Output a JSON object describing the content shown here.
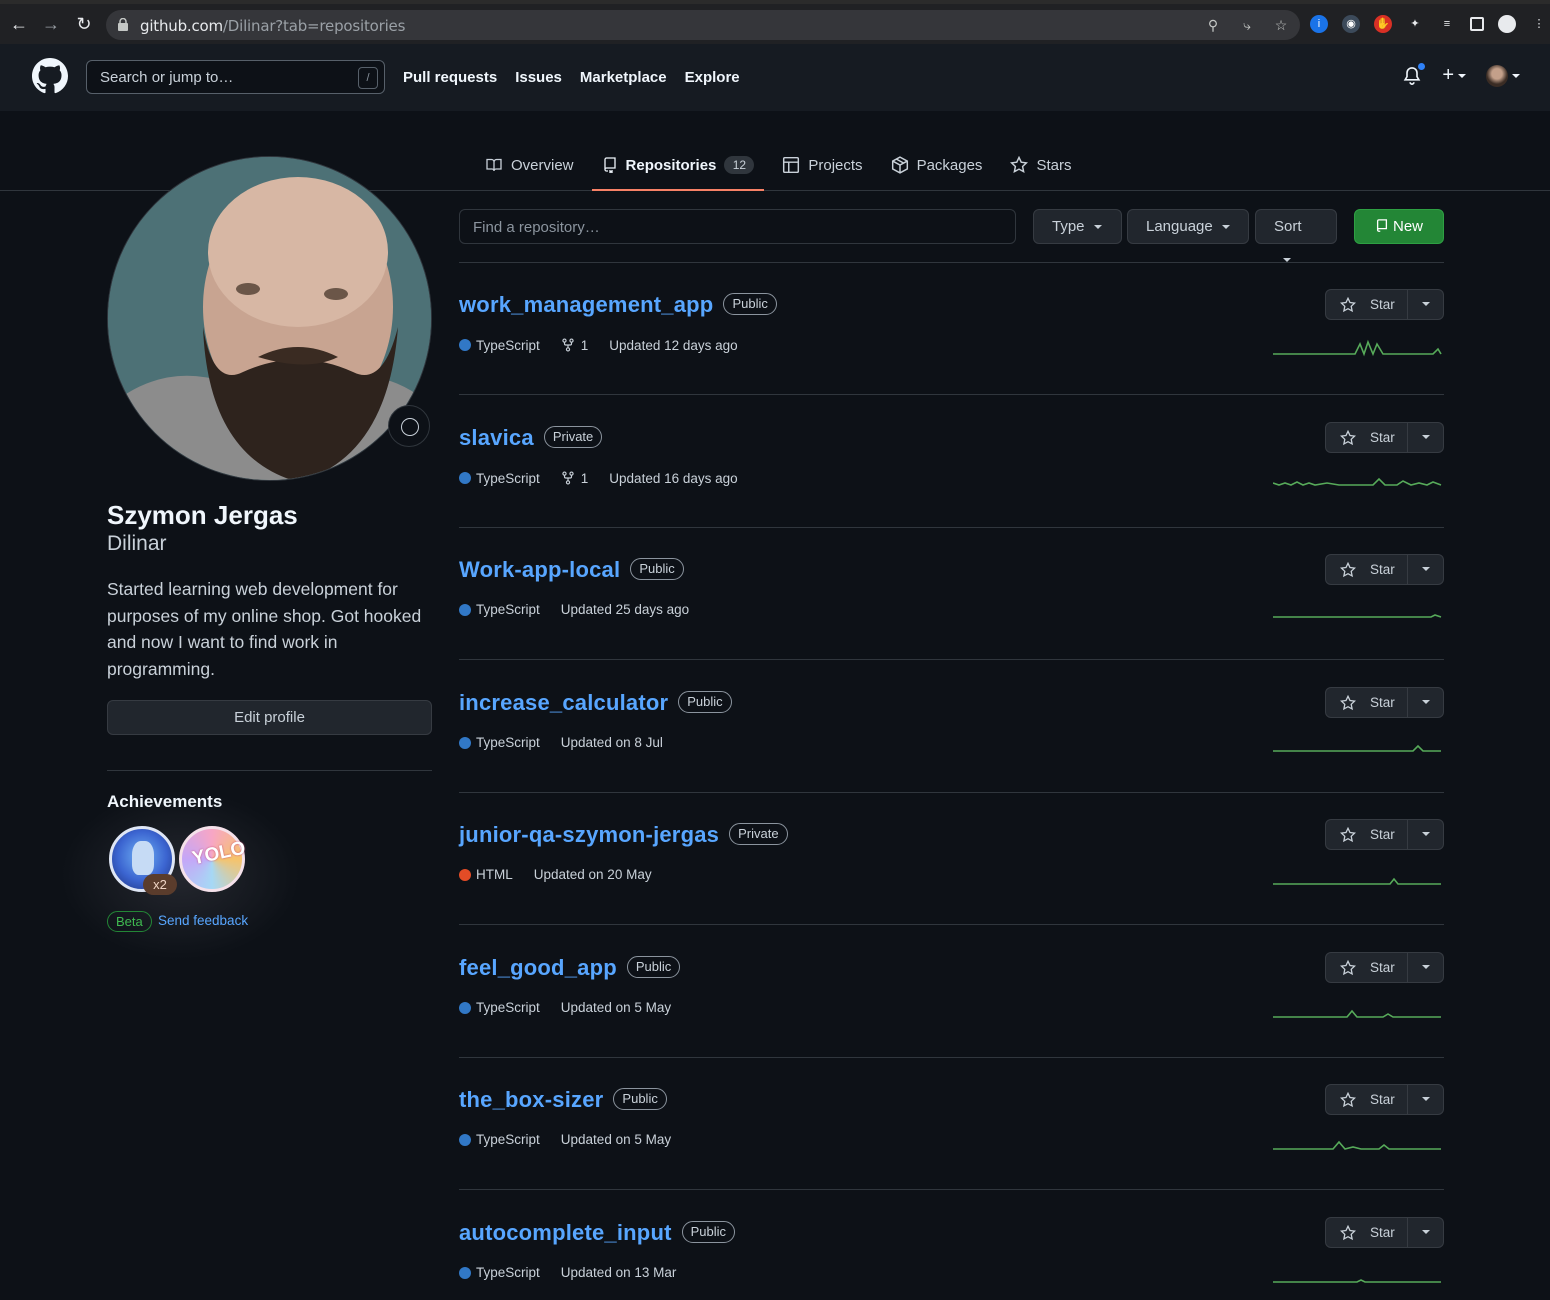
{
  "browser": {
    "url_host": "github.com",
    "url_path": "/Dilinar?tab=repositories"
  },
  "header": {
    "search_placeholder": "Search or jump to…",
    "search_shortcut": "/",
    "nav": [
      "Pull requests",
      "Issues",
      "Marketplace",
      "Explore"
    ]
  },
  "tabs": [
    {
      "label": "Overview",
      "icon": "book-icon"
    },
    {
      "label": "Repositories",
      "icon": "repo-icon",
      "count": "12",
      "active": true
    },
    {
      "label": "Projects",
      "icon": "table-icon"
    },
    {
      "label": "Packages",
      "icon": "package-icon"
    },
    {
      "label": "Stars",
      "icon": "star-icon"
    }
  ],
  "profile": {
    "name": "Szymon Jergas",
    "login": "Dilinar",
    "bio": "Started learning web development for purposes of my online shop. Got hooked and now I want to find work in programming.",
    "edit_label": "Edit profile",
    "achievements_title": "Achievements",
    "badge_count": "x2",
    "badge_yolo": "YOLO",
    "beta_label": "Beta",
    "feedback_label": "Send feedback"
  },
  "filters": {
    "find_placeholder": "Find a repository…",
    "type_label": "Type",
    "language_label": "Language",
    "sort_label": "Sort",
    "new_label": "New"
  },
  "colors": {
    "typescript": "#3178c6",
    "html": "#e34c26",
    "accent": "#f78166",
    "link": "#58a6ff",
    "spark": "#57ab5a"
  },
  "repos": [
    {
      "name": "work_management_app",
      "visibility": "Public",
      "language": "TypeScript",
      "forks": "1",
      "updated": "Updated 12 days ago",
      "star_label": "Star"
    },
    {
      "name": "slavica",
      "visibility": "Private",
      "language": "TypeScript",
      "forks": "1",
      "updated": "Updated 16 days ago",
      "star_label": "Star"
    },
    {
      "name": "Work-app-local",
      "visibility": "Public",
      "language": "TypeScript",
      "updated": "Updated 25 days ago",
      "star_label": "Star"
    },
    {
      "name": "increase_calculator",
      "visibility": "Public",
      "language": "TypeScript",
      "updated": "Updated on 8 Jul",
      "star_label": "Star"
    },
    {
      "name": "junior-qa-szymon-jergas",
      "visibility": "Private",
      "language": "HTML",
      "updated": "Updated on 20 May",
      "star_label": "Star"
    },
    {
      "name": "feel_good_app",
      "visibility": "Public",
      "language": "TypeScript",
      "updated": "Updated on 5 May",
      "star_label": "Star"
    },
    {
      "name": "the_box-sizer",
      "visibility": "Public",
      "language": "TypeScript",
      "updated": "Updated on 5 May",
      "star_label": "Star"
    },
    {
      "name": "autocomplete_input",
      "visibility": "Public",
      "language": "TypeScript",
      "updated": "Updated on 13 Mar",
      "star_label": "Star"
    }
  ]
}
